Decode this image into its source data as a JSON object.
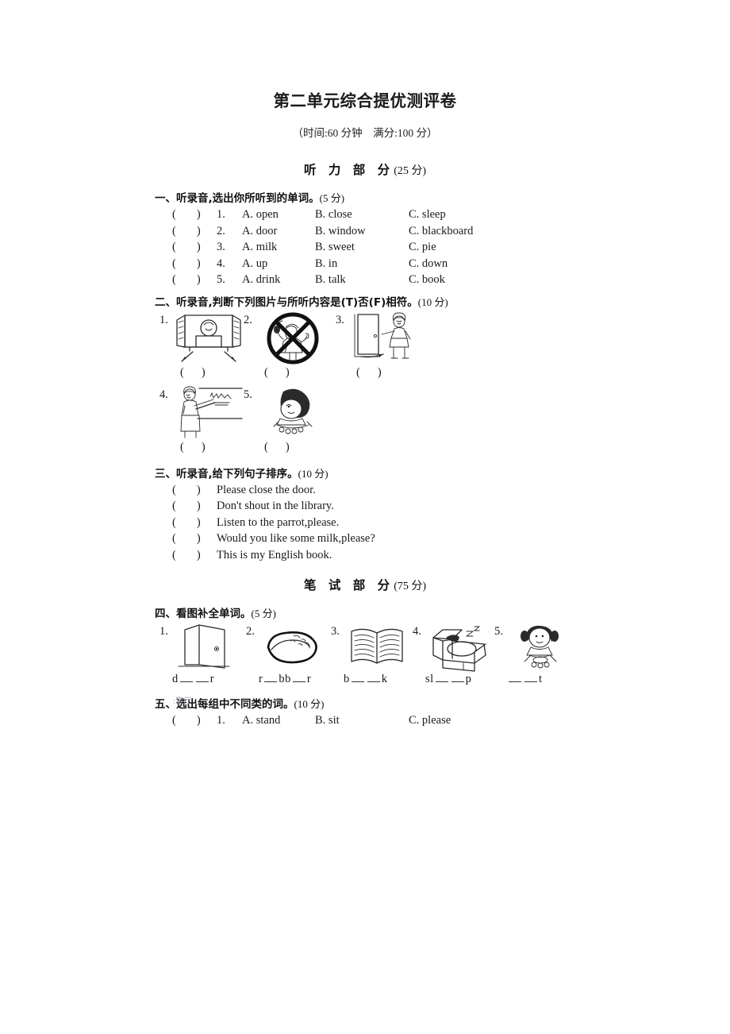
{
  "paper": {
    "title": "第二单元综合提优测评卷",
    "subtitle": "（时间:60 分钟　满分:100 分）",
    "watermark": ":客厅"
  },
  "parts": {
    "listening": {
      "label": "听 力 部 分",
      "score": "(25 分)"
    },
    "written": {
      "label": "笔 试 部 分",
      "score": "(75 分)"
    }
  },
  "sections": [
    {
      "id": "section-1",
      "heading": "一、听录音,选出你所听到的单词。",
      "score": "(5 分)",
      "items": [
        {
          "paren": "(",
          "paren_close": ")",
          "num": "1.",
          "a": "A.  open",
          "b": "B.  close",
          "c": "C.  sleep"
        },
        {
          "paren": "(",
          "paren_close": ")",
          "num": "2.",
          "a": "A.  door",
          "b": "B.  window",
          "c": "C.  blackboard"
        },
        {
          "paren": "(",
          "paren_close": ")",
          "num": "3.",
          "a": "A.  milk",
          "b": "B.  sweet",
          "c": "C.  pie"
        },
        {
          "paren": "(",
          "paren_close": ")",
          "num": "4.",
          "a": "A.  up",
          "b": "B.  in",
          "c": "C.  down"
        },
        {
          "paren": "(",
          "paren_close": ")",
          "num": "5.",
          "a": "A.  drink",
          "b": "B.  talk",
          "c": "C.  book"
        }
      ]
    },
    {
      "id": "section-2",
      "heading": "二、听录音,判断下列图片与所听内容是(T)否(F)相符。",
      "score": "(10 分)",
      "pictures": [
        {
          "num": "1.",
          "icon": "open-window-picture"
        },
        {
          "num": "2.",
          "icon": "no-shouting-sign-picture"
        },
        {
          "num": "3.",
          "icon": "girl-at-door-picture"
        },
        {
          "num": "4.",
          "icon": "teacher-blackboard-picture"
        },
        {
          "num": "5.",
          "icon": "child-eating-picture"
        }
      ]
    },
    {
      "id": "section-3",
      "heading": "三、听录音,给下列句子排序。",
      "score": "(10 分)",
      "sentences": [
        "Please close the door.",
        "Don't shout in the library.",
        "Listen to the parrot,please.",
        "Would you like some milk,please?",
        "This is my English book."
      ]
    },
    {
      "id": "section-4",
      "heading": "四、看图补全单词。",
      "score": "(5 分)",
      "words": [
        {
          "num": "1.",
          "icon": "door-picture",
          "prefix": "d",
          "mid": "",
          "suffix": "r",
          "blanks_before": 0,
          "blanks_mid": 2,
          "blanks_after": 0
        },
        {
          "num": "2.",
          "icon": "rubber-eraser-picture",
          "prefix": "r",
          "mid": "bb",
          "suffix": "r",
          "blanks_before": 0,
          "blanks_mid": 1,
          "blanks_after": 1
        },
        {
          "num": "3.",
          "icon": "open-book-picture",
          "prefix": "b",
          "mid": "",
          "suffix": "k",
          "blanks_before": 0,
          "blanks_mid": 2,
          "blanks_after": 0
        },
        {
          "num": "4.",
          "icon": "bed-sleeping-picture",
          "prefix": "sl",
          "mid": "",
          "suffix": "p",
          "blanks_before": 0,
          "blanks_mid": 2,
          "blanks_after": 0
        },
        {
          "num": "5.",
          "icon": "girl-eating-picture",
          "prefix": "",
          "mid": "",
          "suffix": "t",
          "blanks_before": 2,
          "blanks_mid": 0,
          "blanks_after": 0
        }
      ]
    },
    {
      "id": "section-5",
      "heading": "五、选出每组中不同类的词。",
      "score": "(10 分)",
      "items": [
        {
          "paren": "(",
          "paren_close": ")",
          "num": "1.",
          "a": "A.  stand",
          "b": "B.  sit",
          "c": "C.  please"
        }
      ]
    }
  ]
}
